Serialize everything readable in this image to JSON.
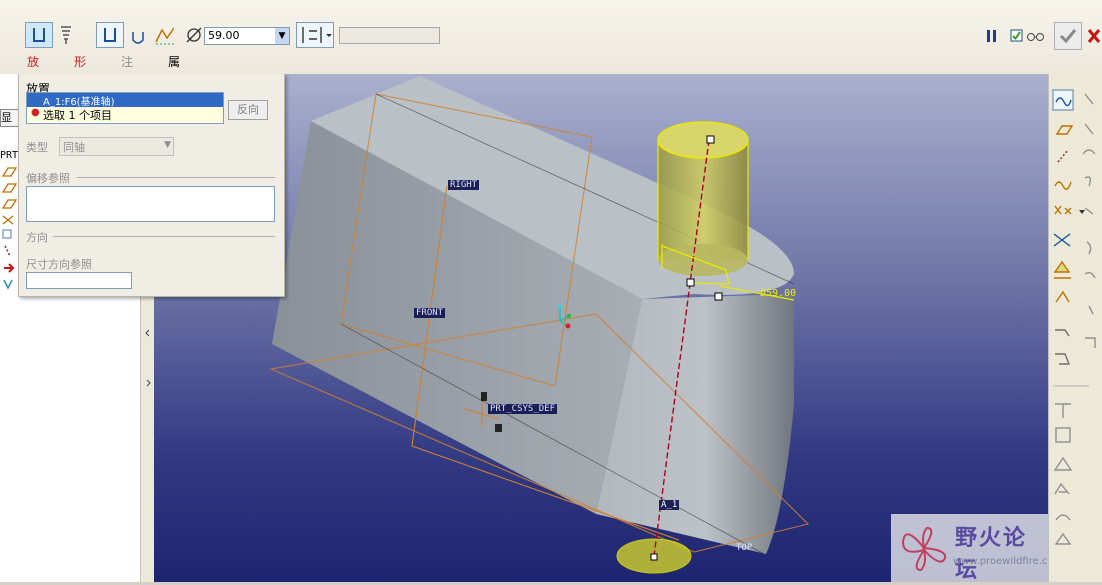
{
  "dashboard": {
    "diameter_value": "59.00",
    "tabs": [
      "放置",
      "形状",
      "注释",
      "属性"
    ]
  },
  "placement": {
    "title": "放置",
    "refs_row1": "A_1:F6(基准轴)",
    "refs_row2": "选取 1 个项目",
    "reverse_button": "反向",
    "type_label": "类型",
    "type_value": "同轴",
    "offset_refs_label": "偏移参照",
    "direction_label": "方向",
    "dim_dir_ref_label": "尺寸方向参照"
  },
  "tree": {
    "tab_label": "显示",
    "root_label": "PRT"
  },
  "viewport": {
    "labels": {
      "right": "RIGHT",
      "front": "FRONT",
      "top": "TOP",
      "csys": "PRT_CSYS_DEF",
      "axis": "A_1",
      "dim": "Ø59.00"
    }
  },
  "watermark": {
    "brand": "野火论坛",
    "url": "www.proewildfire.cn"
  },
  "colors": {
    "accent_blue": "#316ac5",
    "feature_yellow": "#d8d000",
    "datum_orange": "#d08030"
  }
}
